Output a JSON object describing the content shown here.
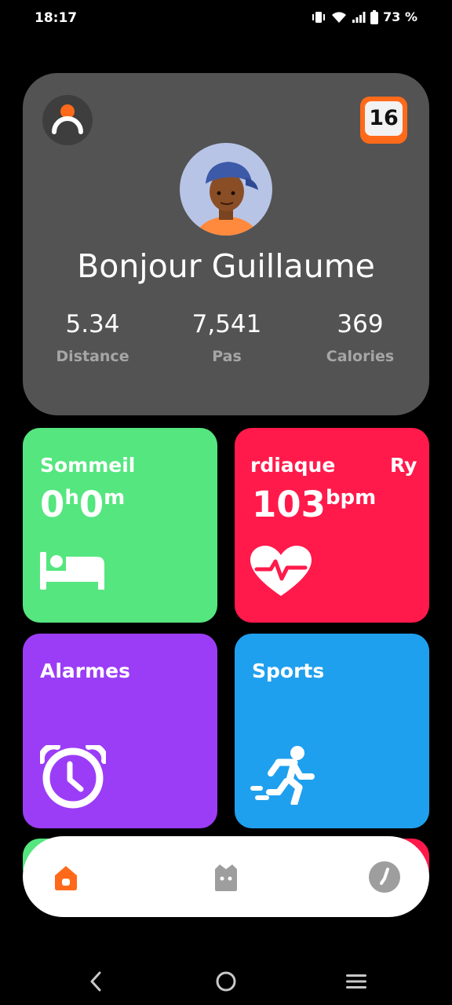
{
  "status_bar": {
    "time": "18:17",
    "battery": "73 %",
    "icons": [
      "vibrate-icon",
      "wifi-icon",
      "signal-icon",
      "battery-icon"
    ]
  },
  "profile": {
    "greeting": "Bonjour Guillaume",
    "calendar_day": "16",
    "stats": [
      {
        "value": "5.34",
        "label": "Distance"
      },
      {
        "value": "7,541",
        "label": "Pas"
      },
      {
        "value": "369",
        "label": "Calories"
      }
    ]
  },
  "tiles": {
    "sleep": {
      "title": "Sommeil",
      "hours": "0",
      "hours_unit": "h",
      "minutes": "0",
      "minutes_unit": "m",
      "color": "#55e67f",
      "icon": "bed-icon"
    },
    "heart": {
      "title": "rdiaque",
      "title_next": "Ry",
      "value": "103",
      "unit": "bpm",
      "color": "#ff1a4b",
      "icon": "heart-rate-icon"
    },
    "alarms": {
      "title": "Alarmes",
      "color": "#9b3df7",
      "icon": "alarm-clock-icon"
    },
    "sports": {
      "title": "Sports",
      "color": "#1fa0ee",
      "icon": "running-icon"
    }
  },
  "bottom_nav": {
    "items": [
      {
        "icon": "home-icon",
        "active": true
      },
      {
        "icon": "watch-face-icon",
        "active": false
      },
      {
        "icon": "history-clock-icon",
        "active": false
      }
    ],
    "accent": "#ff6a1a"
  },
  "system_nav": [
    "back-icon",
    "home-circle-icon",
    "recents-icon"
  ]
}
